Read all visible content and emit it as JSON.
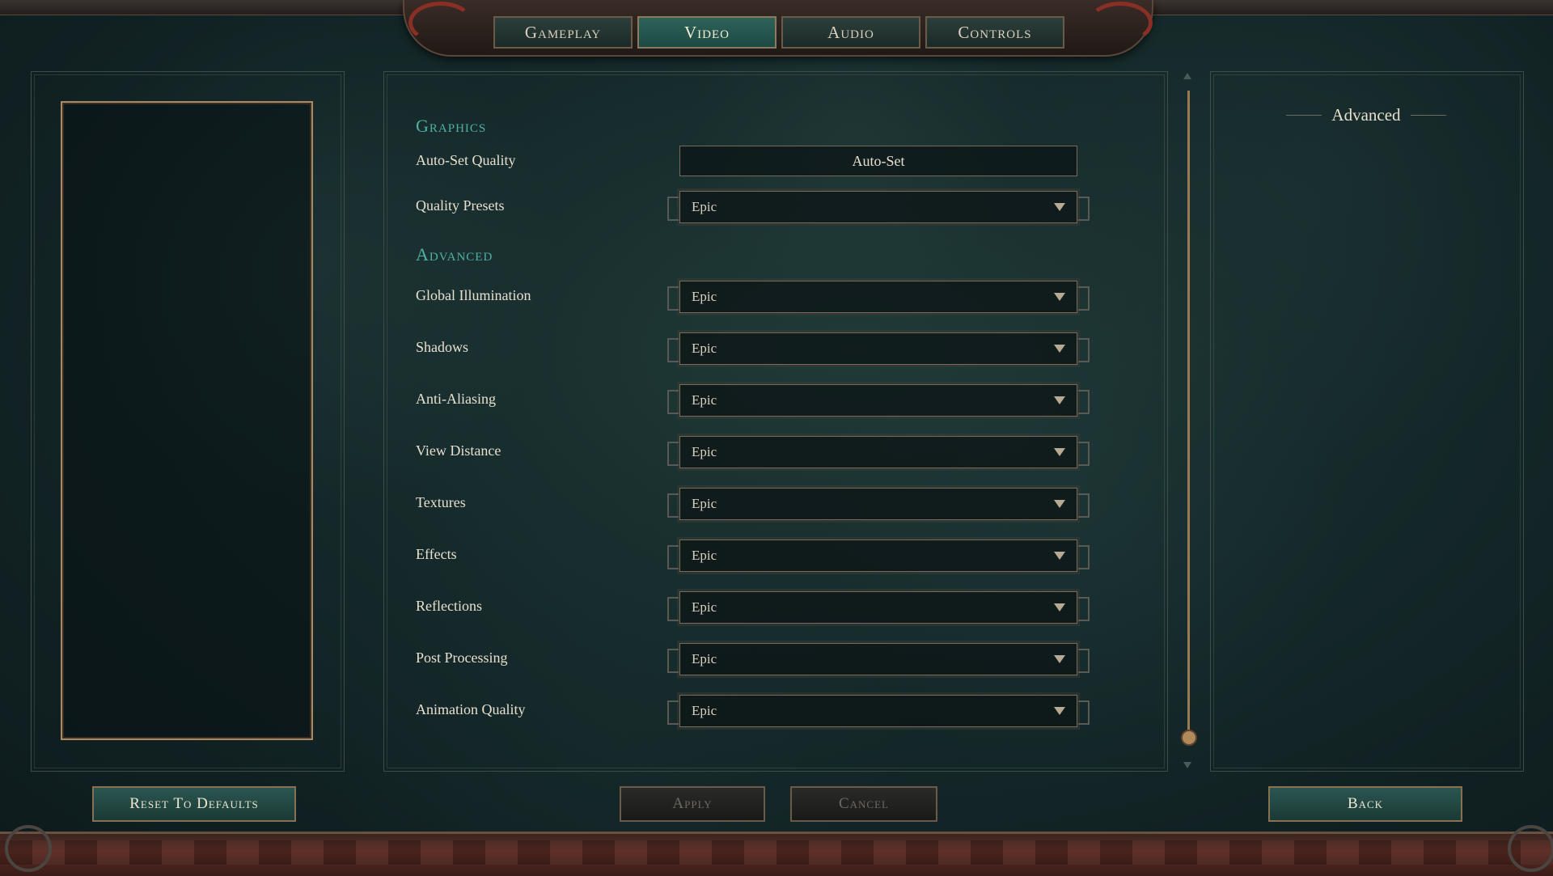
{
  "tabs": [
    {
      "label": "Gameplay",
      "active": false
    },
    {
      "label": "Video",
      "active": true
    },
    {
      "label": "Audio",
      "active": false
    },
    {
      "label": "Controls",
      "active": false
    }
  ],
  "graphics": {
    "title": "Graphics",
    "auto_set_quality": {
      "label": "Auto-Set Quality",
      "button": "Auto-Set"
    },
    "quality_presets": {
      "label": "Quality Presets",
      "value": "Epic"
    }
  },
  "advanced": {
    "title": "Advanced",
    "settings": [
      {
        "label": "Global Illumination",
        "value": "Epic"
      },
      {
        "label": "Shadows",
        "value": "Epic"
      },
      {
        "label": "Anti-Aliasing",
        "value": "Epic"
      },
      {
        "label": "View Distance",
        "value": "Epic"
      },
      {
        "label": "Textures",
        "value": "Epic"
      },
      {
        "label": "Effects",
        "value": "Epic"
      },
      {
        "label": "Reflections",
        "value": "Epic"
      },
      {
        "label": "Post Processing",
        "value": "Epic"
      },
      {
        "label": "Animation Quality",
        "value": "Epic"
      }
    ]
  },
  "right_panel": {
    "header": "Advanced"
  },
  "buttons": {
    "reset": "Reset To Defaults",
    "apply": "Apply",
    "cancel": "Cancel",
    "back": "Back"
  },
  "colors": {
    "accent_teal": "#4fb0a5",
    "active_tab": "#2e6259",
    "frame_gold": "#a98a62",
    "border_red": "#5a2a22"
  }
}
